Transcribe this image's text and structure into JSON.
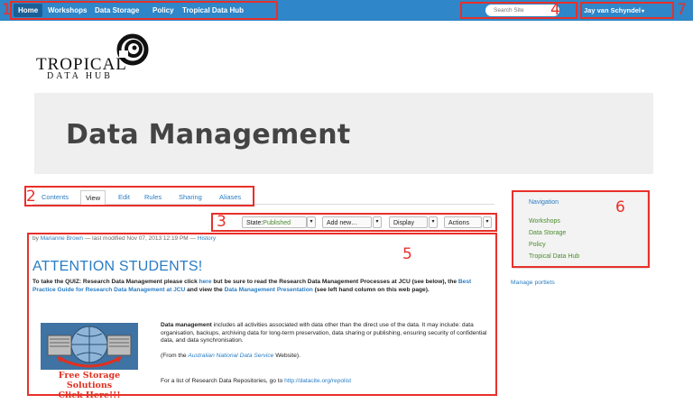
{
  "nav": {
    "items": [
      "Home",
      "Workshops",
      "Data Storage",
      "Policy",
      "Tropical Data Hub"
    ]
  },
  "search": {
    "placeholder": "Search Site"
  },
  "user": {
    "name": "Jay van Schyndel",
    "caret": "▾"
  },
  "logo": {
    "line1": "TROPICAL",
    "line2": "DATA HUB"
  },
  "page": {
    "title": "Data Management"
  },
  "tabs": [
    "Contents",
    "View",
    "Edit",
    "Rules",
    "Sharing",
    "Aliases"
  ],
  "actions": {
    "state_label": "State:",
    "state_value": "Published",
    "add_new": "Add new…",
    "display": "Display",
    "actions": "Actions",
    "caret": "▾"
  },
  "byline": {
    "prefix": "by",
    "author": "Marianne Brown",
    "modified": "— last modified Nov 07, 2013 12:19 PM —",
    "history": "History"
  },
  "content": {
    "heading": "ATTENTION STUDENTS!",
    "quiz_a": "To take the QUIZ: Research Data Management please click",
    "quiz_here": "here",
    "quiz_b": "but be sure to read the Research Data Management Processes at JCU (see below), the",
    "quiz_guide": "Best Practice Guide for Research Data Management at JCU",
    "quiz_c": "and view the",
    "quiz_pres": "Data Management Presentation",
    "quiz_d": "(see left hand column on this web page).",
    "dm_bold": "Data management",
    "dm_text": "includes all activities associated with data other than the direct use of the data. It may include: data organisation, backups, archiving data for long-term preservation, data sharing or publishing, ensuring security of confidential data, and data synchronisation.",
    "from_a": "(From the",
    "from_link": "Australian National Data Service",
    "from_b": "Website).",
    "repo_text": "For a list of Research Data Repositories, go to",
    "repo_link": "http://datacite.org/repolist",
    "storage_line1": "Free Storage Solutions",
    "storage_line2": "Click Here!!!"
  },
  "sidebar": {
    "heading": "Navigation",
    "items": [
      "Workshops",
      "Data Storage",
      "Policy",
      "Tropical Data Hub"
    ],
    "manage": "Manage portlets"
  },
  "annotations": [
    "1",
    "2",
    "3",
    "4",
    "5",
    "6",
    "7"
  ]
}
